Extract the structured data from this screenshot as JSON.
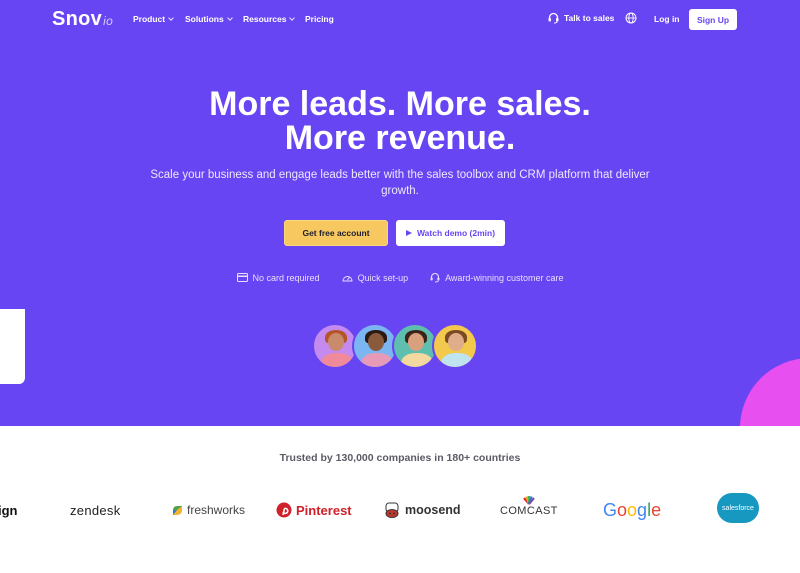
{
  "nav": {
    "logo_main": "Snov",
    "logo_suffix": "io",
    "items": [
      {
        "label": "Product",
        "has_dropdown": true
      },
      {
        "label": "Solutions",
        "has_dropdown": true
      },
      {
        "label": "Resources",
        "has_dropdown": true
      },
      {
        "label": "Pricing",
        "has_dropdown": false
      }
    ],
    "talk_to_sales": "Talk to sales",
    "language_icon": "globe-icon",
    "login": "Log in",
    "signup": "Sign Up"
  },
  "hero": {
    "headline_line1": "More leads. More sales.",
    "headline_line2": "More revenue.",
    "subtitle": "Scale your business and engage leads better with the sales toolbox and CRM platform that deliver growth.",
    "primary_cta": "Get free account",
    "secondary_cta": "Watch demo (2min)",
    "features": [
      {
        "icon": "credit-card-icon",
        "label": "No card required"
      },
      {
        "icon": "speedometer-icon",
        "label": "Quick set-up"
      },
      {
        "icon": "headset-icon",
        "label": "Award-winning customer care"
      }
    ],
    "avatars": [
      {
        "bg": "#c58af0",
        "hair": "#b5552a",
        "shirt": "#f08a9a"
      },
      {
        "bg": "#7bb6f2",
        "hair": "#2a1a12",
        "shirt": "#e79ab8"
      },
      {
        "bg": "#5fbfae",
        "hair": "#3a2418",
        "shirt": "#f3d8a0"
      },
      {
        "bg": "#f2c94c",
        "hair": "#7a4a22",
        "shirt": "#bfe3ef"
      }
    ]
  },
  "trust": {
    "heading": "Trusted by 130,000 companies in 180+ countries",
    "logos": [
      "ign",
      "zendesk",
      "freshworks",
      "Pinterest",
      "moosend",
      "COMCAST",
      "Google",
      "salesforce"
    ]
  },
  "colors": {
    "brand_purple": "#6845f2",
    "cta_yellow": "#f6c85f",
    "accent_pink": "#e84ff0"
  }
}
